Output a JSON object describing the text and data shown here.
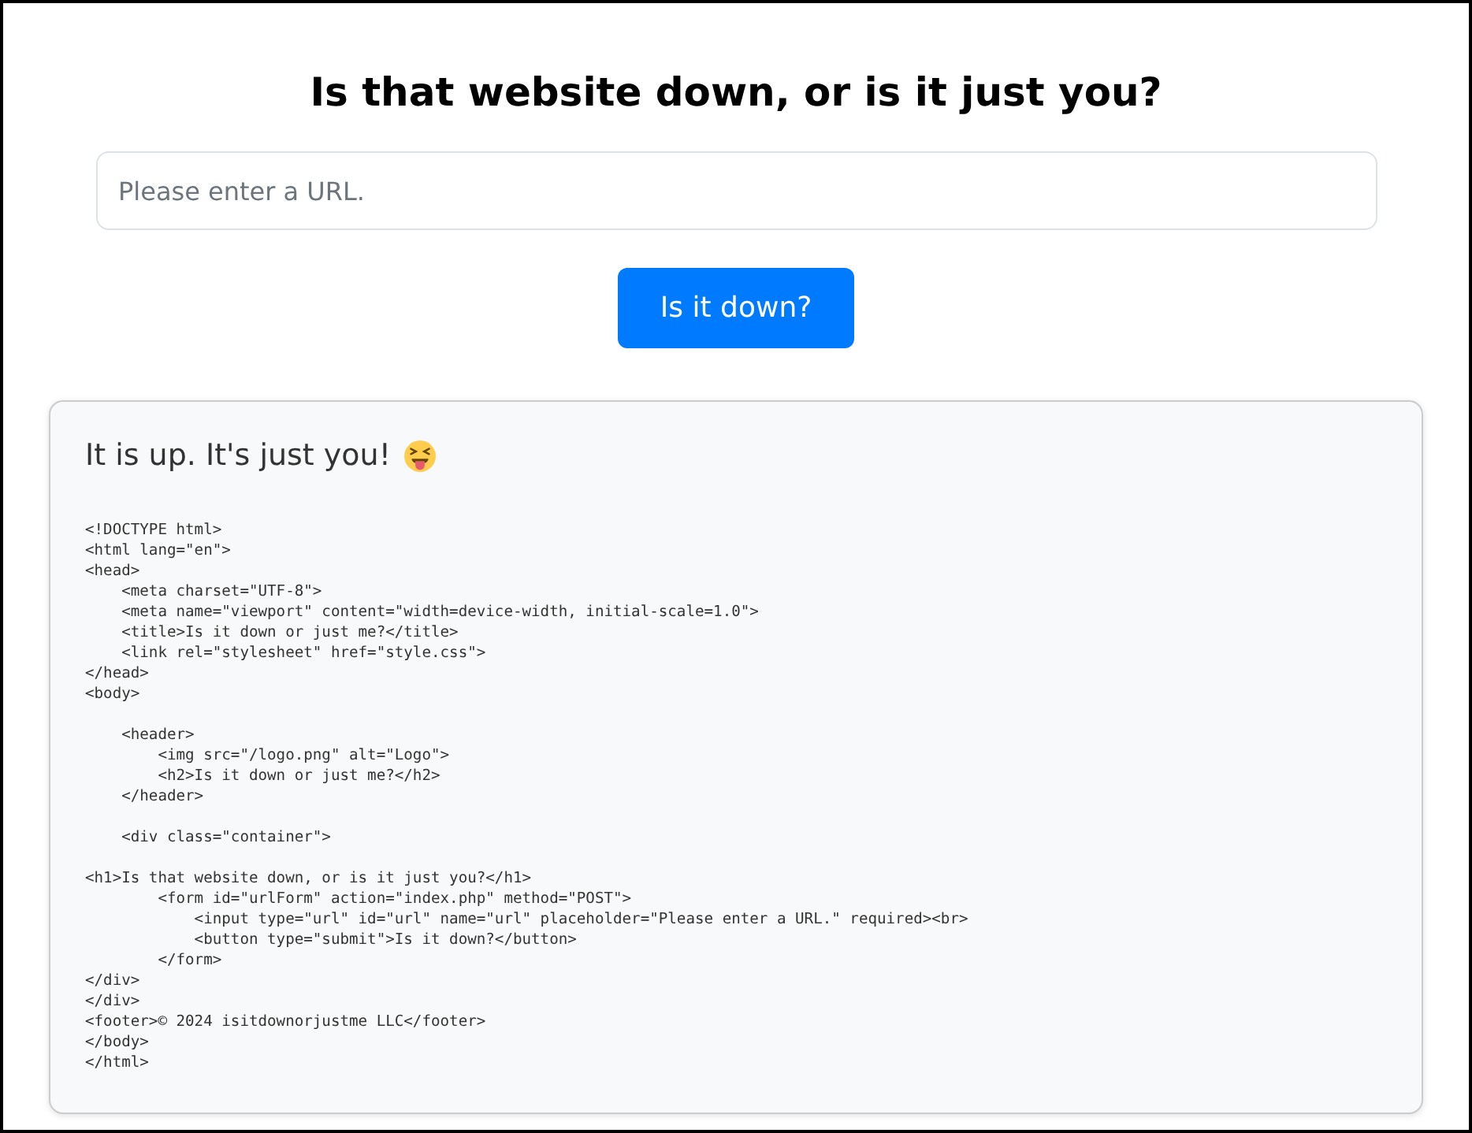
{
  "heading": "Is that website down, or is it just you?",
  "url_field": {
    "placeholder": "Please enter a URL."
  },
  "submit_button": "Is it down?",
  "result": {
    "message": "It is up. It's just you!",
    "source": "<!DOCTYPE html>\n<html lang=\"en\">\n<head>\n    <meta charset=\"UTF-8\">\n    <meta name=\"viewport\" content=\"width=device-width, initial-scale=1.0\">\n    <title>Is it down or just me?</title>\n    <link rel=\"stylesheet\" href=\"style.css\">\n</head>\n<body>\n\n    <header>\n        <img src=\"/logo.png\" alt=\"Logo\">\n        <h2>Is it down or just me?</h2>\n    </header>\n\n    <div class=\"container\">\n\n<h1>Is that website down, or is it just you?</h1>\n        <form id=\"urlForm\" action=\"index.php\" method=\"POST\">\n            <input type=\"url\" id=\"url\" name=\"url\" placeholder=\"Please enter a URL.\" required><br>\n            <button type=\"submit\">Is it down?</button>\n        </form>\n</div>\n</div>\n<footer>© 2024 isitdownorjustme LLC</footer>\n</body>\n</html>"
  }
}
